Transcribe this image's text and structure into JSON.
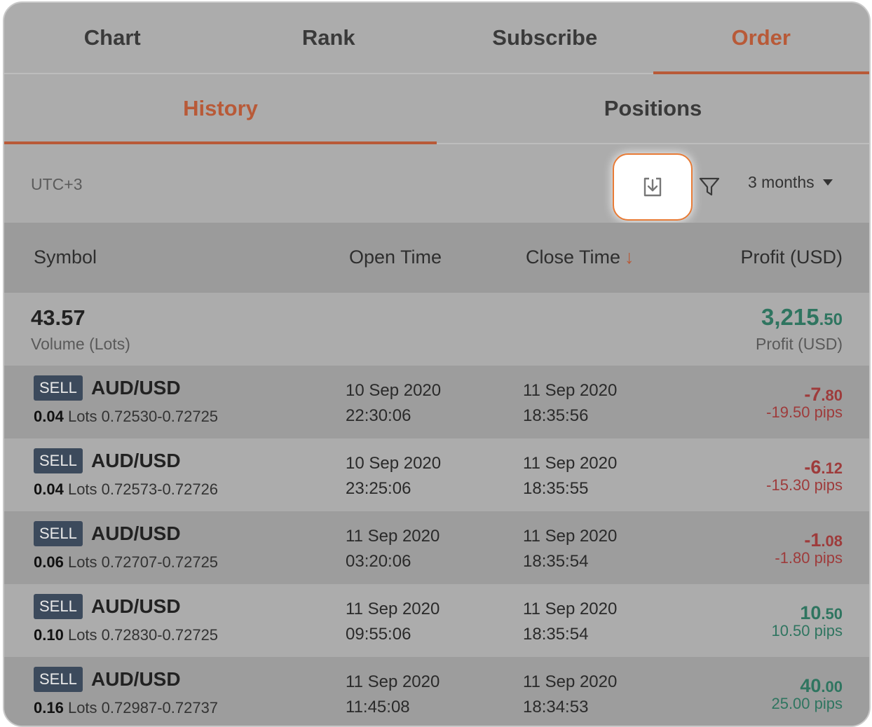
{
  "top_tabs": [
    "Chart",
    "Rank",
    "Subscribe",
    "Order"
  ],
  "top_tabs_active": "Order",
  "sub_tabs": [
    "History",
    "Positions"
  ],
  "sub_tabs_active": "History",
  "toolbar": {
    "timezone": "UTC+3",
    "download_icon": "download-icon",
    "filter_icon": "filter-icon",
    "range_label": "3 months"
  },
  "columns": {
    "symbol": "Symbol",
    "open_time": "Open Time",
    "close_time": "Close Time",
    "close_sort_arrow": "↓",
    "profit": "Profit (USD)"
  },
  "summary": {
    "volume": "43.57",
    "volume_label": "Volume (Lots)",
    "profit_int": "3,215",
    "profit_dec": ".50",
    "profit_label": "Profit (USD)"
  },
  "rows": [
    {
      "side": "SELL",
      "symbol": "AUD/USD",
      "lots": "0.04",
      "lots_label": "Lots",
      "range": "0.72530-0.72725",
      "open_date": "10 Sep 2020",
      "open_time": "22:30:06",
      "close_date": "11 Sep 2020",
      "close_time": "18:35:56",
      "profit_int": "-7",
      "profit_dec": ".80",
      "pips": "-19.50 pips",
      "sign": "neg"
    },
    {
      "side": "SELL",
      "symbol": "AUD/USD",
      "lots": "0.04",
      "lots_label": "Lots",
      "range": "0.72573-0.72726",
      "open_date": "10 Sep 2020",
      "open_time": "23:25:06",
      "close_date": "11 Sep 2020",
      "close_time": "18:35:55",
      "profit_int": "-6",
      "profit_dec": ".12",
      "pips": "-15.30 pips",
      "sign": "neg"
    },
    {
      "side": "SELL",
      "symbol": "AUD/USD",
      "lots": "0.06",
      "lots_label": "Lots",
      "range": "0.72707-0.72725",
      "open_date": "11 Sep 2020",
      "open_time": "03:20:06",
      "close_date": "11 Sep 2020",
      "close_time": "18:35:54",
      "profit_int": "-1",
      "profit_dec": ".08",
      "pips": "-1.80 pips",
      "sign": "neg"
    },
    {
      "side": "SELL",
      "symbol": "AUD/USD",
      "lots": "0.10",
      "lots_label": "Lots",
      "range": "0.72830-0.72725",
      "open_date": "11 Sep 2020",
      "open_time": "09:55:06",
      "close_date": "11 Sep 2020",
      "close_time": "18:35:54",
      "profit_int": "10",
      "profit_dec": ".50",
      "pips": "10.50 pips",
      "sign": "pos"
    },
    {
      "side": "SELL",
      "symbol": "AUD/USD",
      "lots": "0.16",
      "lots_label": "Lots",
      "range": "0.72987-0.72737",
      "open_date": "11 Sep 2020",
      "open_time": "11:45:08",
      "close_date": "11 Sep 2020",
      "close_time": "18:34:53",
      "profit_int": "40",
      "profit_dec": ".00",
      "pips": "25.00 pips",
      "sign": "pos"
    }
  ],
  "colors": {
    "accent": "#b85a38",
    "highlight_border": "#e87b36",
    "positive": "#2f7560",
    "negative": "#9e3b3b",
    "badge_bg": "#3c4a5c"
  }
}
